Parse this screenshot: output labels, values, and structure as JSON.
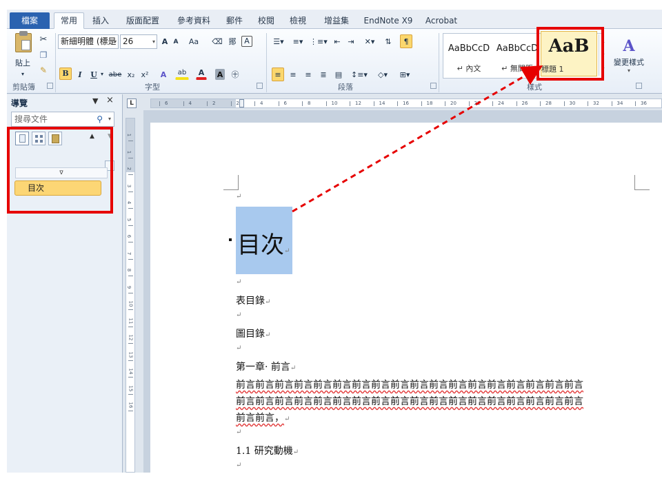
{
  "ribbon_tabs": [
    "檔案",
    "常用",
    "插入",
    "版面配置",
    "參考資料",
    "郵件",
    "校閱",
    "檢視",
    "增益集",
    "EndNote X9",
    "Acrobat"
  ],
  "clipboard": {
    "paste_label": "貼上",
    "group_label": "剪貼簿"
  },
  "font": {
    "name": "新細明體 (標是",
    "size": "26",
    "group_label": "字型",
    "grow": "A",
    "shrink": "A",
    "case_label": "Aa",
    "phonetic_label": "鄮",
    "border_char": "A",
    "bold": "B",
    "italic": "I",
    "underline": "U",
    "strike": "abe",
    "subscript": "x₂",
    "superscript": "x²",
    "highlight": "ab",
    "color_a": "A",
    "shade_a": "A",
    "circled": "㊉",
    "enclosed": "中",
    "highlight_color": "#f5e11a",
    "font_color": "#e02020"
  },
  "paragraph": {
    "group_label": "段落"
  },
  "styles": {
    "group_label": "樣式",
    "items": [
      {
        "sample": "AaBbCcD",
        "name": "↵ 內文"
      },
      {
        "sample": "AaBbCcD",
        "name": "↵ 無間距"
      },
      {
        "sample": "AaB",
        "name": "標題 1"
      }
    ],
    "change_styles_label": "變更樣式",
    "change_styles_glyph": "A"
  },
  "nav": {
    "title": "導覽",
    "dropdown": "▼",
    "close": "×",
    "search_placeholder": "搜尋文件",
    "search_icon": "search-icon",
    "up_arrow": "▲",
    "down_arrow": "▼",
    "collapse_glyph": "ᐁ",
    "headings": [
      "目次"
    ]
  },
  "ruler": {
    "corner": "L",
    "h_labels": [
      "6",
      "4",
      "2",
      "2",
      "4",
      "6",
      "8",
      "10",
      "12",
      "14",
      "16",
      "18",
      "20",
      "22",
      "24",
      "26",
      "28",
      "30",
      "32",
      "34",
      "36"
    ],
    "v_labels": [
      "1",
      "1",
      "2",
      "3",
      "4",
      "5",
      "6",
      "7",
      "8",
      "9",
      "10",
      "11",
      "12",
      "13",
      "14",
      "15",
      "16"
    ]
  },
  "document": {
    "paragraph_mark": "↵",
    "heading": "目次",
    "lines": [
      "表目錄",
      "圖目錄",
      "第一章· 前言",
      "前言前言前言前言前言前言前言前言前言前言前言前言前言前言前言前言前言前言",
      "前言前言前言前言前言前言前言前言前言前言前言前言前言前言前言前言前言前言",
      "前言前言，",
      "1.1 研究動機"
    ]
  },
  "annotation_colors": {
    "box": "#e60000",
    "arrow": "#e60000"
  }
}
